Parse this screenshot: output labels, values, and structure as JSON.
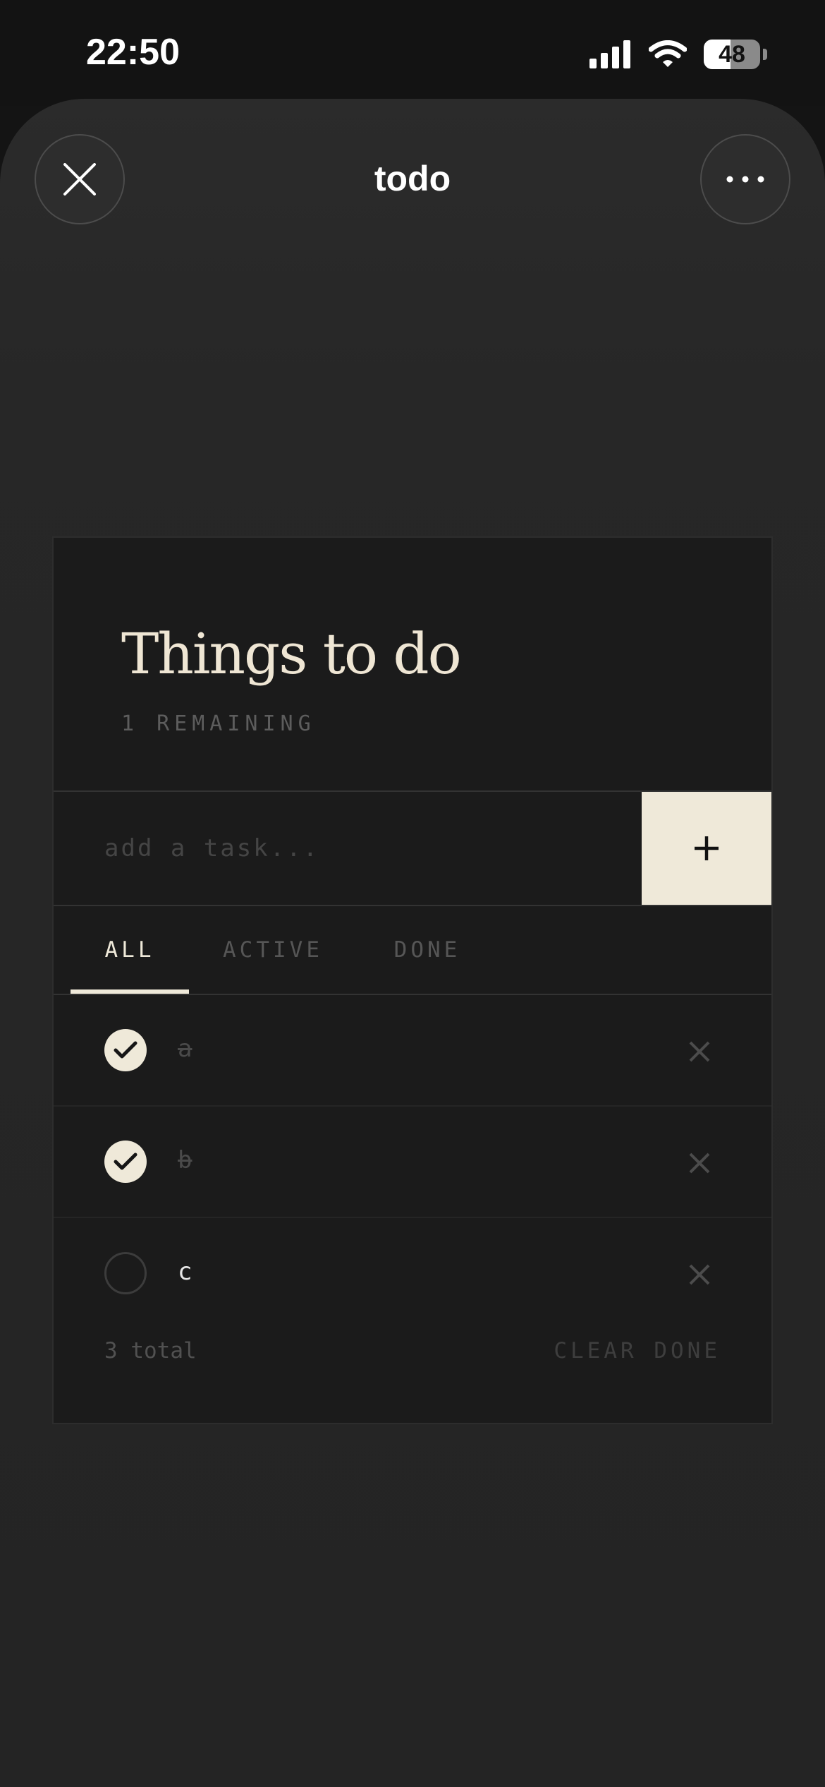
{
  "status_bar": {
    "time": "22:50",
    "battery_level": "48",
    "battery_fraction": 0.48,
    "icons": [
      "signal-icon",
      "wifi-icon",
      "battery-icon"
    ]
  },
  "sheet": {
    "title": "todo",
    "close_icon": "close-icon",
    "more_icon": "more-icon"
  },
  "app": {
    "heading": "Things to do",
    "remaining": "1 REMAINING",
    "input_placeholder": "add a task...",
    "input_value": "",
    "add_label": "+",
    "tabs": [
      {
        "label": "ALL",
        "selected": true
      },
      {
        "label": "ACTIVE",
        "selected": false
      },
      {
        "label": "DONE",
        "selected": false
      }
    ],
    "tasks": [
      {
        "text": "a",
        "done": true
      },
      {
        "text": "b",
        "done": true
      },
      {
        "text": "c",
        "done": false
      }
    ],
    "total": "3 total",
    "clear_done": "CLEAR DONE"
  },
  "colors": {
    "background": "#141414",
    "sheet": "#272727",
    "card": "#1b1b1b",
    "accent": "#efe9d9",
    "heading": "#efe6d4"
  }
}
